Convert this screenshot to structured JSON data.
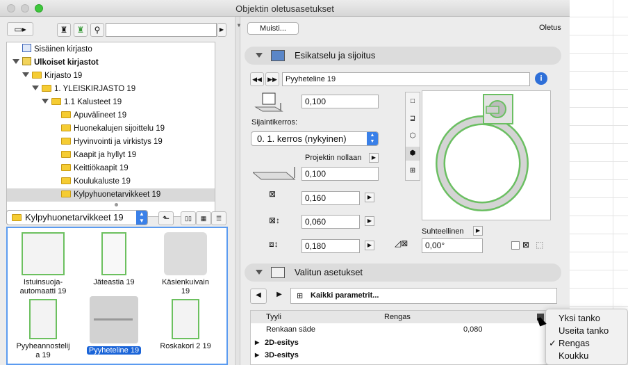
{
  "window": {
    "title": "Objektin oletusasetukset"
  },
  "left": {
    "tree": [
      {
        "label": "Sisäinen kirjasto",
        "icon": "library-icon",
        "bold": false
      },
      {
        "label": "Ulkoiset kirjastot",
        "icon": "external-library-icon",
        "bold": true
      },
      {
        "label": "Kirjasto 19",
        "icon": "folder-icon",
        "bold": false
      },
      {
        "label": "1. YLEISKIRJASTO 19",
        "icon": "folder-icon",
        "bold": false
      },
      {
        "label": "1.1 Kalusteet 19",
        "icon": "folder-icon",
        "bold": false
      },
      {
        "label": "Apuvälineet 19",
        "icon": "folder-icon",
        "bold": false
      },
      {
        "label": "Huonekalujen sijoittelu 19",
        "icon": "folder-icon",
        "bold": false
      },
      {
        "label": "Hyvinvointi ja virkistys 19",
        "icon": "folder-icon",
        "bold": false
      },
      {
        "label": "Kaapit ja hyllyt 19",
        "icon": "folder-icon",
        "bold": false
      },
      {
        "label": "Keittiökaapit 19",
        "icon": "folder-icon",
        "bold": false
      },
      {
        "label": "Koulukaluste 19",
        "icon": "folder-icon",
        "bold": false
      },
      {
        "label": "Kylpyhuonetarvikkeet 19",
        "icon": "folder-icon",
        "bold": false
      }
    ],
    "folder_select": "Kylpyhuonetarvikkeet 19",
    "items": [
      {
        "label": "Istuinsuoja-\nautomaatti 19"
      },
      {
        "label": "Jäteastia 19"
      },
      {
        "label": "Käsienkuivain\n19"
      },
      {
        "label": "Pyyheannostelij\na 19"
      },
      {
        "label": "Pyyheteline 19",
        "selected": true
      },
      {
        "label": "Roskakori 2 19"
      }
    ]
  },
  "right": {
    "favorites_button": "Muisti...",
    "default_label": "Oletus",
    "section_preview": "Esikatselu ja sijoitus",
    "object_name": "Pyyheteline 19",
    "elevation_value": "0,100",
    "storey_label": "Sijaintikerros:",
    "storey_value": "0. 1. kerros (nykyinen)",
    "project_zero_label": "Projektin nollaan",
    "project_zero_value": "0,100",
    "dim_a": "0,160",
    "dim_b": "0,060",
    "dim_c": "0,180",
    "relative_label": "Suhteellinen",
    "angle_value": "0,00°",
    "section_selected": "Valitun asetukset",
    "all_params": "Kaikki parametrit...",
    "params": {
      "header_name": "Tyyli",
      "header_value": "Rengas",
      "row1_name": "Renkaan säde",
      "row1_value": "0,080",
      "group1": "2D-esitys",
      "group2": "3D-esitys"
    }
  },
  "menu": {
    "items": [
      {
        "label": "Yksi tanko",
        "checked": false
      },
      {
        "label": "Useita tanko",
        "checked": false
      },
      {
        "label": "Rengas",
        "checked": true
      },
      {
        "label": "Koukku",
        "checked": false
      }
    ],
    "check": "✓"
  }
}
